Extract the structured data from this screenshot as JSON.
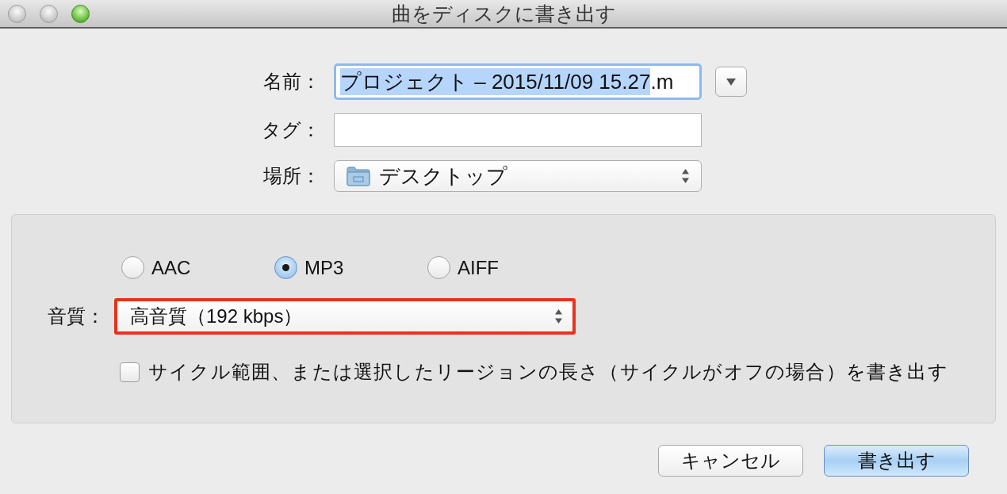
{
  "window": {
    "title": "曲をディスクに書き出す",
    "controls": [
      {
        "kind": "close",
        "enabled": false
      },
      {
        "kind": "minimize",
        "enabled": false
      },
      {
        "kind": "zoom",
        "enabled": true
      }
    ]
  },
  "form": {
    "name": {
      "label": "名前：",
      "value_segments": [
        {
          "text": "プロジェクト – 2015/11/09 15.27",
          "selected": true
        },
        {
          "text": ".m",
          "selected": false
        }
      ]
    },
    "tags": {
      "label": "タグ："
    },
    "location": {
      "label": "場所：",
      "value": "デスクトップ"
    }
  },
  "options": {
    "formats": [
      {
        "label": "AAC",
        "selected": false
      },
      {
        "label": "MP3",
        "selected": true
      },
      {
        "label": "AIFF",
        "selected": false
      }
    ],
    "quality": {
      "label": "音質：",
      "value": "高音質（192 kbps）",
      "highlighted": true
    },
    "export_cycle": {
      "label": "サイクル範囲、または選択したリージョンの長さ（サイクルがオフの場合）を書き出す",
      "checked": false
    }
  },
  "buttons": [
    {
      "label": "キャンセル",
      "default": false
    },
    {
      "label": "書き出す",
      "default": true
    }
  ]
}
